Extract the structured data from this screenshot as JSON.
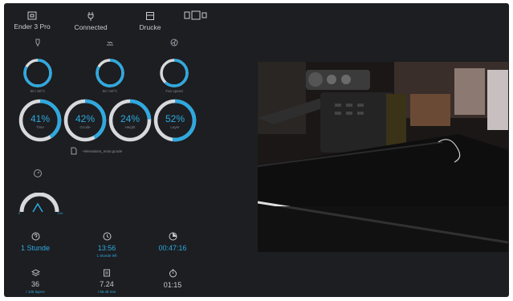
{
  "top": {
    "printer_name": "Ender 3 Pro",
    "status": "Connected",
    "prints_label": "Drucke"
  },
  "temps": [
    {
      "label": "50 / 60°C",
      "fraction": 0.83
    },
    {
      "label": "50 / 60°C",
      "fraction": 0.83
    },
    {
      "label": "Fan speed",
      "fraction": 0.62
    }
  ],
  "progress": [
    {
      "value": "41%",
      "label": "Time",
      "fraction": 0.41
    },
    {
      "value": "42%",
      "label": "Gcode",
      "fraction": 0.42
    },
    {
      "value": "24%",
      "label": "Height",
      "fraction": 0.24
    },
    {
      "value": "52%",
      "label": "Layer",
      "fraction": 0.52
    }
  ],
  "file": {
    "name": "~/elevations_moto.gcode"
  },
  "speed_gauge": {
    "min": "0",
    "max": "100",
    "fraction": 0.4
  },
  "stats_row1": [
    {
      "value": "1 Stunde",
      "sub": "",
      "icon": "help-icon"
    },
    {
      "value": "13:56",
      "sub": "1 Stunde left",
      "icon": "clock-icon"
    },
    {
      "value": "00:47:16",
      "sub": "",
      "icon": "elapsed-icon"
    }
  ],
  "stats_row2": [
    {
      "value": "36",
      "sub": "/ 105 layers",
      "icon": "layers-icon"
    },
    {
      "value": "7.24",
      "sub": "/ 55.48 mm",
      "icon": "height-icon"
    },
    {
      "value": "01:15",
      "sub": "",
      "icon": "timer-icon"
    }
  ],
  "colors": {
    "background": "#1c1e21",
    "accent": "#2ea9e0",
    "track": "#d7d9dc",
    "text": "#c9ccd1"
  }
}
